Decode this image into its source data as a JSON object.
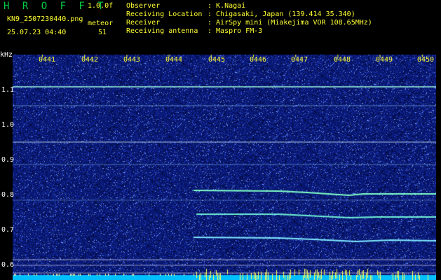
{
  "header": {
    "app_name": "H R O F F T",
    "version": "1.0.0f",
    "filename": "KN9_2507230440.png",
    "meteor_label": "meteor",
    "datetime": "25.07.23 04:40",
    "meteor_count": "51",
    "info_rows": [
      {
        "label": "Observer",
        "value": ": K.Nagai"
      },
      {
        "label": "Receiving Location",
        "value": ": Chigasaki, Japan (139.414 35.340)"
      },
      {
        "label": "Receiver",
        "value": ": AirSpy mini (Miakejima VOR 108.65MHz)"
      },
      {
        "label": "Receiving antenna",
        "value": ": Maspro FM-3"
      }
    ]
  },
  "axis": {
    "unit": "kHz",
    "y_labels": [
      "1.1",
      "1.0",
      "0.9",
      "0.8",
      "0.7",
      "0.6"
    ],
    "time_labels": [
      "0441",
      "0442",
      "0443",
      "0444",
      "0445",
      "0446",
      "0447",
      "0448",
      "0449",
      "0450"
    ]
  },
  "colors": {
    "background": "#000000",
    "noise_base": "#0a1a78",
    "signal": "#7fffd0",
    "header_accent": "#00cc44",
    "tick_text": "#ffff33",
    "bottom_bar": "#00ccff"
  }
}
